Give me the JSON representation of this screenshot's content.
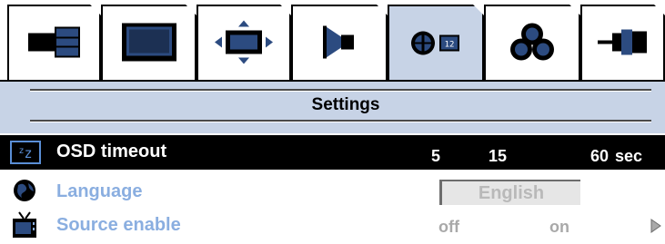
{
  "tabs": [
    {
      "icon": "picture-adjust-icon",
      "active": false
    },
    {
      "icon": "monitor-icon",
      "active": false
    },
    {
      "icon": "position-icon",
      "active": false
    },
    {
      "icon": "audio-icon",
      "active": false
    },
    {
      "icon": "settings-clock-icon",
      "active": true
    },
    {
      "icon": "color-icon",
      "active": false
    },
    {
      "icon": "input-connector-icon",
      "active": false
    }
  ],
  "panel": {
    "title": "Settings"
  },
  "rows": {
    "osd_timeout": {
      "label": "OSD timeout",
      "icon": "sleep-zz-icon",
      "values": [
        "5",
        "15",
        "60"
      ],
      "unit": "sec"
    },
    "language": {
      "label": "Language",
      "icon": "globe-icon",
      "value": "English"
    },
    "source_enable": {
      "label": "Source enable",
      "icon": "tv-source-icon",
      "off": "off",
      "on": "on",
      "arrow": "play-right-icon"
    }
  },
  "colors": {
    "panel": "#c7d3e6",
    "selected_row": "#000000",
    "dim_label": "#8aaee0"
  }
}
